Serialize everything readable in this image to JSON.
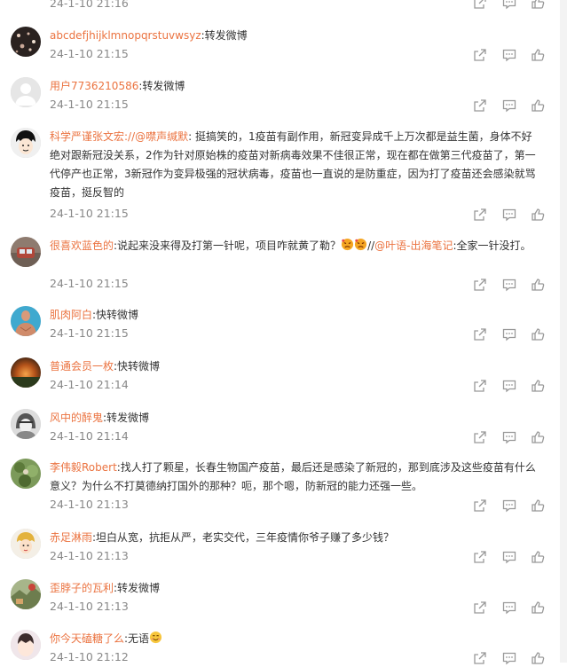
{
  "comments": [
    {
      "user": "",
      "text": "",
      "time": "24-1-10 21:16"
    },
    {
      "user": "abcdefjhijklmnopqrstuvwsyz",
      "text": ":转发微博",
      "time": "24-1-10 21:15"
    },
    {
      "user": "用户7736210586",
      "text": ":转发微博",
      "time": "24-1-10 21:15"
    },
    {
      "user": "科学严谨张文宏",
      "mention1": "://@噤声缄默",
      "text": ": 挺搞笑的，1疫苗有副作用，新冠变异成千上万次都是益生菌，身体不好绝对跟新冠没关系，2作为针对原始株的疫苗对新病毒效果不佳很正常，现在都在做第三代疫苗了，第一代停产也正常，3新冠作为变异极强的冠状病毒，疫苗也一直说的是防重症，因为打了疫苗还会感染就骂疫苗，挺反智的",
      "time": "24-1-10 21:15"
    },
    {
      "user": "很喜欢蓝色的",
      "text": ":说起来没来得及打第一针呢，项目咋就黄了勒？",
      "text2": "//",
      "mention1": "@叶语-出海笔记",
      "text3": ":全家一针没打。",
      "time": "24-1-10 21:15"
    },
    {
      "user": "肌肉阿白",
      "text": ":快转微博",
      "time": "24-1-10 21:15"
    },
    {
      "user": "普通会员一枚",
      "text": ":快转微博",
      "time": "24-1-10 21:14"
    },
    {
      "user": "风中的醉鬼",
      "text": ":转发微博",
      "time": "24-1-10 21:14"
    },
    {
      "user": "李伟毅Robert",
      "text": ":找人打了颗星，长春生物国产疫苗，最后还是感染了新冠的，那到底涉及这些疫苗有什么意义？为什么不打莫德纳打国外的那种？呃，那个嗯，防新冠的能力还强一些。",
      "time": "24-1-10 21:13"
    },
    {
      "user": "赤足淋雨",
      "text": ":坦白从宽，抗拒从严，老实交代，三年疫情你爷子赚了多少钱？",
      "time": "24-1-10 21:13"
    },
    {
      "user": "歪脖子的瓦利",
      "text": ":转发微博",
      "time": "24-1-10 21:13"
    },
    {
      "user": "你今天磕糖了么",
      "text": ":无语",
      "time": "24-1-10 21:12"
    }
  ],
  "icons": {
    "share": "share-icon",
    "comment": "comment-icon",
    "like": "like-icon"
  },
  "colors": {
    "username": "#eb7340",
    "text": "#333333",
    "time": "#888888",
    "icon": "#999999"
  }
}
